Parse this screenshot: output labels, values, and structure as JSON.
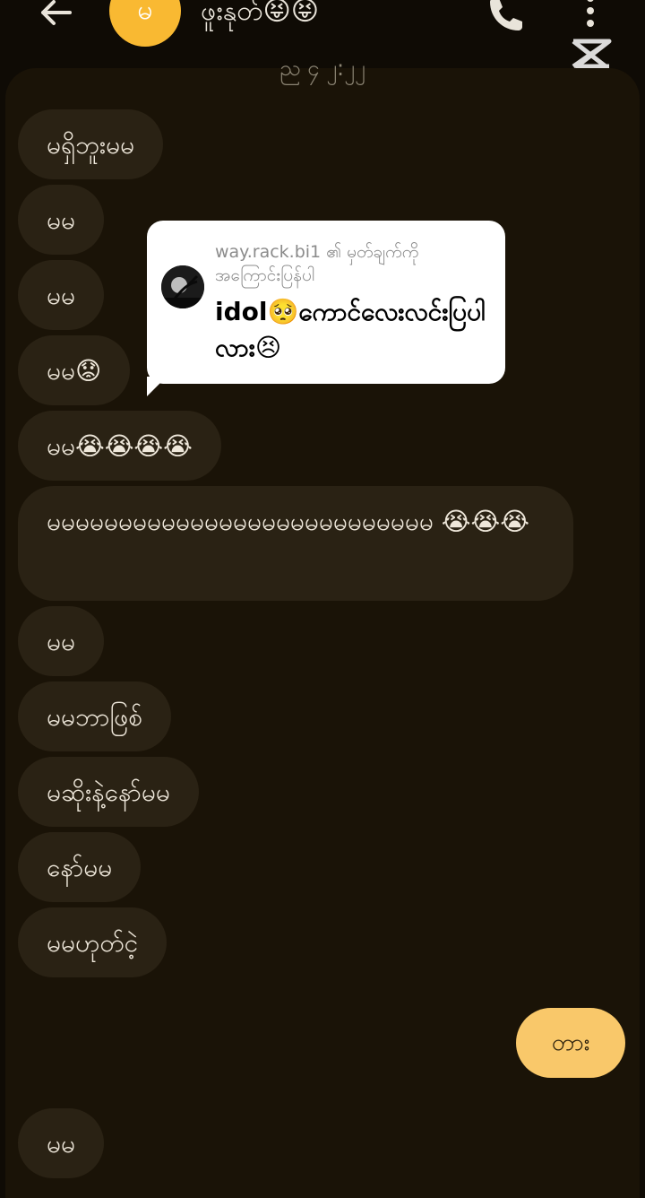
{
  "header": {
    "avatar_letter": "မ",
    "chat_name": "ဖူးနုတ်😝😝"
  },
  "panel": {
    "timestamp": "ည ၄ ၂:၂၂"
  },
  "messages": [
    {
      "text": "မရှိဘူးမမ"
    },
    {
      "text": "မမ"
    },
    {
      "text": "မမ"
    },
    {
      "text": "မမ😟"
    },
    {
      "text": "မမ😭😭😭😭"
    },
    {
      "text": "မမမမမမမမမမမမမမမမမမမမမမမမမမမ 😭😭😭"
    },
    {
      "text": "မမ"
    },
    {
      "text": "မမဘာဖြစ်"
    },
    {
      "text": "မဆိုးနဲ့နော်မမ"
    },
    {
      "text": "နော်မမ"
    },
    {
      "text": "မမဟုတ်ငဲ့"
    },
    {
      "text": "မမ"
    }
  ],
  "quote": {
    "user_line": "way.rack.bi1 ၏ မှတ်ချက်ကို အကြောင်းပြန်ပါ",
    "text": "idol🥺ကောင်လေးလင်းပြပါလား😣"
  },
  "reply_button": {
    "label": "တား"
  }
}
